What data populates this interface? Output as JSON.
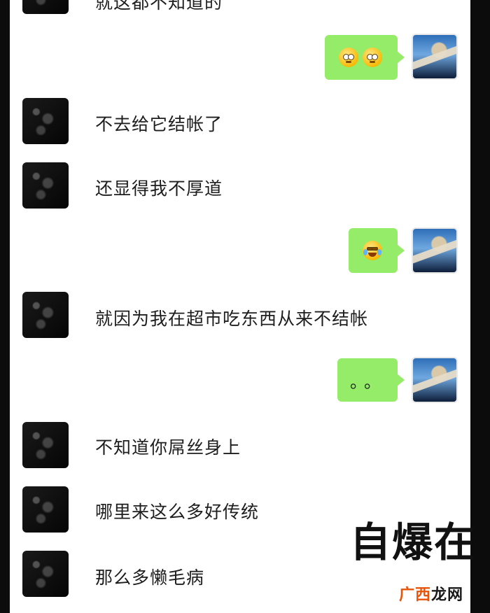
{
  "chat": {
    "cut_top_text": "就这都不知道的",
    "messages": [
      {
        "side": "right",
        "kind": "emoji",
        "emoji": [
          "pleading-face-icon",
          "pleading-face-icon"
        ]
      },
      {
        "side": "left",
        "text": "不去给它结帐了"
      },
      {
        "side": "left",
        "text": "还显得我不厚道"
      },
      {
        "side": "right",
        "kind": "emoji",
        "emoji": [
          "laughing-tears-icon"
        ]
      },
      {
        "side": "left",
        "text": "就因为我在超市吃东西从来不结帐"
      },
      {
        "side": "right",
        "kind": "text",
        "text": "。。"
      },
      {
        "side": "left",
        "text": "不知道你屌丝身上"
      },
      {
        "side": "left",
        "text": "哪里来这么多好传统"
      },
      {
        "side": "left",
        "text": "那么多懒毛病"
      }
    ]
  },
  "overlay": {
    "caption": "自爆在"
  },
  "watermark": {
    "part1": "广西",
    "part2": "龙网"
  },
  "colors": {
    "bubble_green": "#95ec69",
    "background": "#ffffff",
    "watermark": "#e8550a"
  }
}
